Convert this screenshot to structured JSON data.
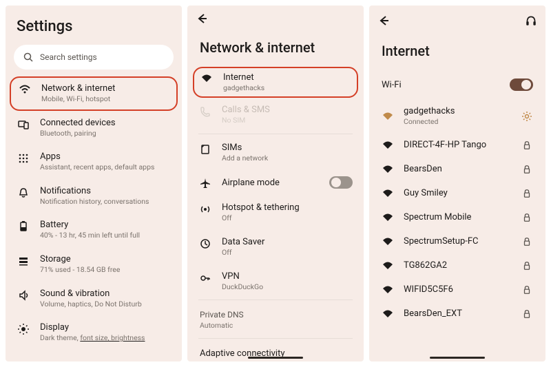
{
  "screen1": {
    "title": "Settings",
    "search_placeholder": "Search settings",
    "items": [
      {
        "label": "Network & internet",
        "sub": "Mobile, Wi-Fi, hotspot"
      },
      {
        "label": "Connected devices",
        "sub": "Bluetooth, pairing"
      },
      {
        "label": "Apps",
        "sub": "Assistant, recent apps, default apps"
      },
      {
        "label": "Notifications",
        "sub": "Notification history, conversations"
      },
      {
        "label": "Battery",
        "sub": "40% - 13 hr, 45 min left until full"
      },
      {
        "label": "Storage",
        "sub": "71% used - 18.54 GB free"
      },
      {
        "label": "Sound & vibration",
        "sub": "Volume, haptics, Do Not Disturb"
      },
      {
        "label": "Display",
        "sub_pre": "Dark theme, ",
        "sub_u": "font size, brightness"
      }
    ]
  },
  "screen2": {
    "title": "Network & internet",
    "items": {
      "internet": {
        "label": "Internet",
        "sub": "gadgethacks"
      },
      "calls": {
        "label": "Calls & SMS",
        "sub": "No SIM"
      },
      "sims": {
        "label": "SIMs",
        "sub": "Add a network"
      },
      "airplane": {
        "label": "Airplane mode"
      },
      "hotspot": {
        "label": "Hotspot & tethering",
        "sub": "Off"
      },
      "datasaver": {
        "label": "Data Saver",
        "sub": "Off"
      },
      "vpn": {
        "label": "VPN",
        "sub": "DuckDuckGo"
      }
    },
    "private_dns": {
      "label": "Private DNS",
      "sub": "Automatic"
    },
    "adaptive": "Adaptive connectivity"
  },
  "screen3": {
    "title": "Internet",
    "wifi_label": "Wi-Fi",
    "networks": [
      {
        "name": "gadgethacks",
        "sub": "Connected",
        "trail": "gear"
      },
      {
        "name": "DIRECT-4F-HP Tango",
        "trail": "lock"
      },
      {
        "name": "BearsDen",
        "trail": "lock"
      },
      {
        "name": "Guy Smiley",
        "trail": "lock"
      },
      {
        "name": "Spectrum Mobile",
        "trail": "lock"
      },
      {
        "name": "SpectrumSetup-FC",
        "trail": "lock"
      },
      {
        "name": "TG862GA2",
        "trail": "lock"
      },
      {
        "name": "WIFID5C5F6",
        "trail": "lock"
      },
      {
        "name": "BearsDen_EXT",
        "trail": "lock"
      }
    ]
  }
}
